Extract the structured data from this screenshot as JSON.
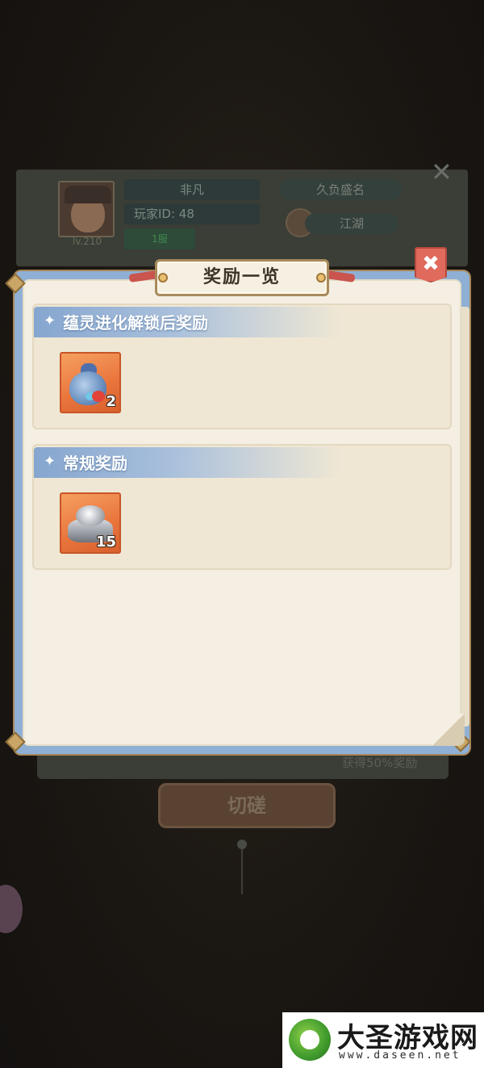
{
  "background_profile": {
    "player_name": "非凡",
    "player_id_label": "玩家ID: 48",
    "level": "lv.210",
    "green_tag": "1服",
    "title": "久负盛名",
    "guild": "江湖"
  },
  "background_lower": {
    "bonus_text": "获得50%奖励",
    "action_button": "切磋"
  },
  "popup": {
    "title": "奖励一览",
    "close_glyph": "✖",
    "sections": [
      {
        "heading": "蕴灵进化解锁后奖励",
        "items": [
          {
            "icon": "pouch-icon",
            "count": "2"
          }
        ]
      },
      {
        "heading": "常规奖励",
        "items": [
          {
            "icon": "silver-ingot-icon",
            "count": "15"
          }
        ]
      }
    ]
  },
  "watermark": {
    "name": "大圣游戏网",
    "url": "www.daseen.net"
  },
  "colors": {
    "panel_frame": "#8fb0d4",
    "panel_paper": "#f4efe2",
    "section_head": "#86a6cf",
    "item_slot": "#e9743c",
    "close_button": "#e06a5c"
  }
}
